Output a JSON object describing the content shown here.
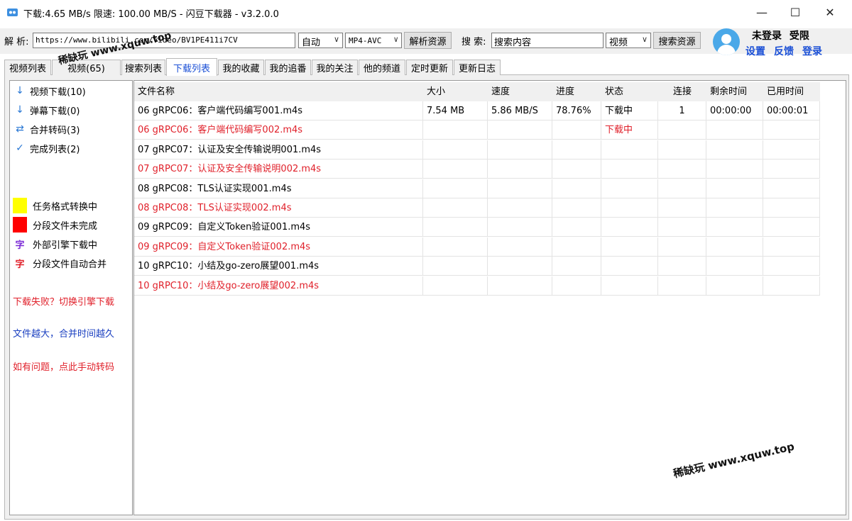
{
  "window": {
    "title": "下载:4.65 MB/s  限速: 100.00 MB/S  - 闪豆下载器 - v3.2.0.0",
    "minimize": "—",
    "maximize": "☐",
    "close": "✕"
  },
  "toolbar": {
    "parse_label": "解 析:",
    "url_value": "https://www.bilibili.com/video/BV1PE411i7CV",
    "quality_value": "自动",
    "format_value": "MP4-AVC",
    "parse_button": "解析资源",
    "search_label": "搜 索:",
    "search_value": "搜索内容",
    "search_type_value": "视频",
    "search_button": "搜索资源"
  },
  "user": {
    "status_login": "未登录",
    "status_limit": "受限",
    "settings": "设置",
    "feedback": "反馈",
    "login": "登录"
  },
  "tabs": [
    {
      "label": "视频列表"
    },
    {
      "label": "视频(65)"
    },
    {
      "label": "搜索列表"
    },
    {
      "label": "下载列表"
    },
    {
      "label": "我的收藏"
    },
    {
      "label": "我的追番"
    },
    {
      "label": "我的关注"
    },
    {
      "label": "他的频道"
    },
    {
      "label": "定时更新"
    },
    {
      "label": "更新日志"
    }
  ],
  "active_tab": "下载列表",
  "sidebar": {
    "categories": [
      {
        "icon": "↓",
        "label": "视频下载(10)"
      },
      {
        "icon": "↓",
        "label": "弹幕下载(0)"
      },
      {
        "icon": "⇄",
        "label": "合并转码(3)"
      },
      {
        "icon": "✓",
        "label": "完成列表(2)"
      }
    ],
    "legend": [
      {
        "color": "#ffff00",
        "label": "任务格式转换中"
      },
      {
        "color": "#ff0000",
        "label": "分段文件未完成"
      },
      {
        "glyph": "字",
        "glyph_color": "#7b2ad6",
        "label": "外部引擎下载中"
      },
      {
        "glyph": "字",
        "glyph_color": "#e0202a",
        "label": "分段文件自动合并"
      }
    ],
    "notes": [
      {
        "text": "下载失败？切换引擎下载",
        "color": "#e0202a"
      },
      {
        "text": "文件越大，合并时间越久",
        "color": "#1a3fc0"
      },
      {
        "text": "如有问题，点此手动转码",
        "color": "#e0202a"
      }
    ]
  },
  "table": {
    "headers": [
      "文件名称",
      "大小",
      "速度",
      "进度",
      "状态",
      "连接",
      "剩余时间",
      "已用时间"
    ],
    "rows": [
      {
        "name": "06 gRPC06：客户端代码编写001.m4s",
        "size": "7.54 MB",
        "speed": "5.86 MB/S",
        "progress": "78.76%",
        "status": "下载中",
        "conn": "1",
        "remain": "00:00:00",
        "used": "00:00:01",
        "red": false
      },
      {
        "name": "06 gRPC06：客户端代码编写002.m4s",
        "size": "",
        "speed": "",
        "progress": "",
        "status": "下载中",
        "conn": "",
        "remain": "",
        "used": "",
        "red": true
      },
      {
        "name": "07 gRPC07：认证及安全传输说明001.m4s",
        "size": "",
        "speed": "",
        "progress": "",
        "status": "",
        "conn": "",
        "remain": "",
        "used": "",
        "red": false
      },
      {
        "name": "07 gRPC07：认证及安全传输说明002.m4s",
        "size": "",
        "speed": "",
        "progress": "",
        "status": "",
        "conn": "",
        "remain": "",
        "used": "",
        "red": true
      },
      {
        "name": "08 gRPC08：TLS认证实现001.m4s",
        "size": "",
        "speed": "",
        "progress": "",
        "status": "",
        "conn": "",
        "remain": "",
        "used": "",
        "red": false
      },
      {
        "name": "08 gRPC08：TLS认证实现002.m4s",
        "size": "",
        "speed": "",
        "progress": "",
        "status": "",
        "conn": "",
        "remain": "",
        "used": "",
        "red": true
      },
      {
        "name": "09 gRPC09：自定义Token验证001.m4s",
        "size": "",
        "speed": "",
        "progress": "",
        "status": "",
        "conn": "",
        "remain": "",
        "used": "",
        "red": false
      },
      {
        "name": "09 gRPC09：自定义Token验证002.m4s",
        "size": "",
        "speed": "",
        "progress": "",
        "status": "",
        "conn": "",
        "remain": "",
        "used": "",
        "red": true
      },
      {
        "name": "10 gRPC10：小结及go-zero展望001.m4s",
        "size": "",
        "speed": "",
        "progress": "",
        "status": "",
        "conn": "",
        "remain": "",
        "used": "",
        "red": false
      },
      {
        "name": "10 gRPC10：小结及go-zero展望002.m4s",
        "size": "",
        "speed": "",
        "progress": "",
        "status": "",
        "conn": "",
        "remain": "",
        "used": "",
        "red": true
      }
    ]
  },
  "watermark": "稀缺玩 www.xquw.top"
}
